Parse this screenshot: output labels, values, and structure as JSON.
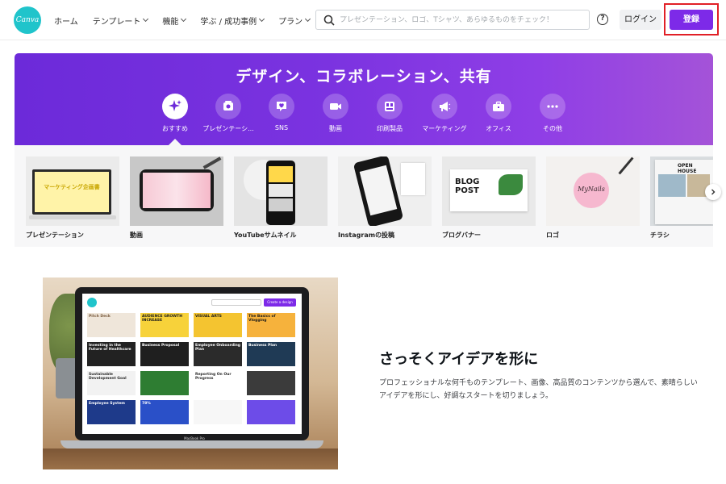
{
  "header": {
    "logo_text": "Canva",
    "nav": [
      {
        "label": "ホーム",
        "has_menu": false
      },
      {
        "label": "テンプレート",
        "has_menu": true
      },
      {
        "label": "機能",
        "has_menu": true
      },
      {
        "label": "学ぶ / 成功事例",
        "has_menu": true
      },
      {
        "label": "プラン",
        "has_menu": true
      }
    ],
    "search_placeholder": "プレゼンテーション、ロゴ、Tシャツ、あらゆるものをチェック！",
    "help_label": "?",
    "login_label": "ログイン",
    "signup_label": "登録"
  },
  "hero": {
    "title": "デザイン、コラボレーション、共有",
    "categories": [
      {
        "label": "おすすめ",
        "icon": "sparkle-icon",
        "active": true
      },
      {
        "label": "プレゼンテーシ...",
        "icon": "presentation-icon",
        "active": false
      },
      {
        "label": "SNS",
        "icon": "heart-chat-icon",
        "active": false
      },
      {
        "label": "動画",
        "icon": "video-icon",
        "active": false
      },
      {
        "label": "印刷製品",
        "icon": "print-icon",
        "active": false
      },
      {
        "label": "マーケティング",
        "icon": "megaphone-icon",
        "active": false
      },
      {
        "label": "オフィス",
        "icon": "briefcase-icon",
        "active": false
      },
      {
        "label": "その他",
        "icon": "more-icon",
        "active": false
      }
    ]
  },
  "templates": [
    {
      "label": "プレゼンテーション"
    },
    {
      "label": "動画"
    },
    {
      "label": "YouTubeサムネイル"
    },
    {
      "label": "Instagramの投稿"
    },
    {
      "label": "ブログバナー"
    },
    {
      "label": "ロゴ"
    },
    {
      "label": "チラシ"
    }
  ],
  "template_art": {
    "presentation_text": "マーケティング企画書",
    "blog_post_text": "BLOG POST",
    "logo_text": "MyNails",
    "flyer_text": "OPEN HOUSE"
  },
  "feature": {
    "title": "さっそくアイデアを形に",
    "description": "プロフェッショナルな何千ものテンプレート、画像、高品質のコンテンツから選んで、素晴らしいアイデアを形にし、好調なスタートを切りましょう。",
    "laptop_cards": [
      "Pitch Deck",
      "AUDIENCE GROWTH INCREASE",
      "VISUAL ARTS",
      "The Basics of Vlogging",
      "Investing in the Future of Healthcare",
      "Business Proposal",
      "Employee Onboarding Plan",
      "Business Plan",
      "Sustainable Development Goal",
      "",
      "Reporting On Our Progress",
      "",
      "Employee System",
      "78%",
      "",
      ""
    ],
    "laptop_search_button": "Create a design",
    "laptop_brand": "MacBook Pro"
  },
  "colors": {
    "brand_purple": "#7d2ae8",
    "logo_teal": "#20c4cb",
    "highlight_red": "#e11f26"
  }
}
